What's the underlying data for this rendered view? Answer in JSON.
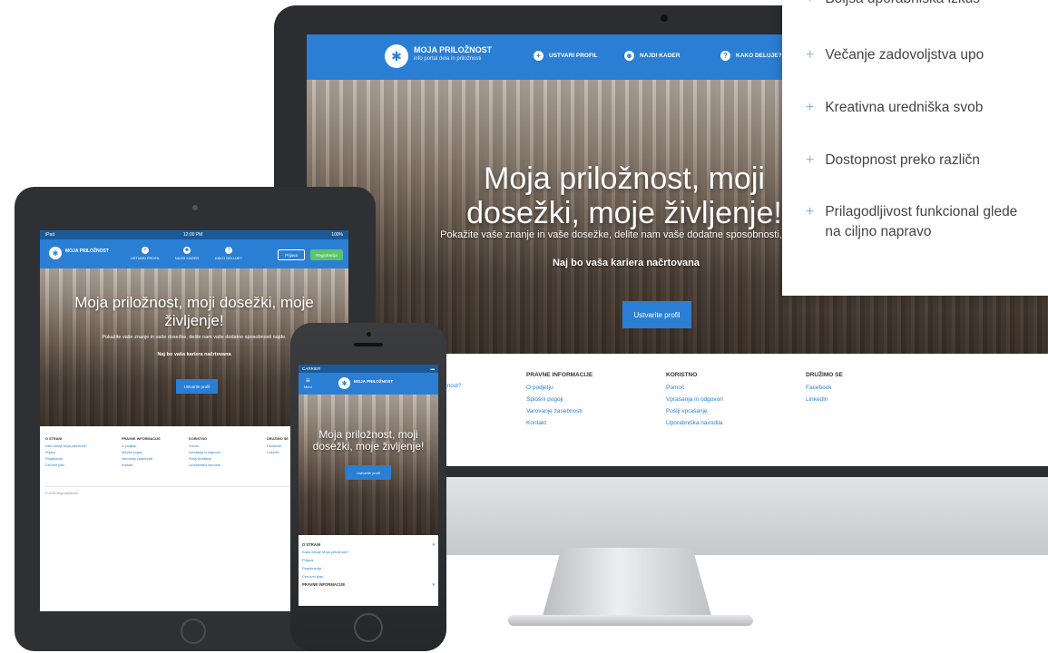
{
  "features": [
    "Boljša uporabniška izkuš",
    "Večanje zadovoljstva upo",
    "Kreativna uredniška svob",
    "Dostopnost preko različn",
    "Prilagodljivost funkcional glede na ciljno napravo"
  ],
  "monitor": {
    "logo_title": "MOJA PRILOŽNOST",
    "logo_subtitle": "info portal dela in priložnosti",
    "nav": [
      "USTVARI PROFIL",
      "NAJDI KADER",
      "KAKO DELUJE?"
    ],
    "hero_title": "Moja priložnost, moji dosežki, moje življenje!",
    "hero_text": "Pokažite vaše znanje in vaše dosežke, delite nam vaše dodatne sposobnosti, najde.",
    "hero_strong": "Naj bo vaša kariera načrtovana",
    "cta": "Ustvarite profil",
    "footer_cut": "iznost?",
    "footer": [
      {
        "heading": "PRAVNE INFORMACIJE",
        "links": [
          "O podjetju",
          "Splošni pogoji",
          "Varovanje zasebnosti",
          "Kontakt"
        ]
      },
      {
        "heading": "KORISTNO",
        "links": [
          "Pomoč",
          "Vprašanja in odgovori",
          "Pošlji vprašanje",
          "Uporabniška navodila"
        ]
      },
      {
        "heading": "DRUŽIMO SE",
        "links": [
          "Facebook",
          "LinkedIn"
        ]
      }
    ]
  },
  "tablet": {
    "status_left": "iPad",
    "status_center": "12:00 PM",
    "status_right": "100%",
    "logo_title": "MOJA PRILOŽNOST",
    "nav": [
      "USTVARI PROFIL",
      "NAJDI KADER",
      "KAKO DELUJE?"
    ],
    "login": "Prijava",
    "register": "Registracija",
    "hero_title": "Moja priložnost, moji dosežki, moje življenje!",
    "hero_text": "Pokažite vaše znanje in vaše dosežke, delite nam vaše dodatne sposobnosti najde.",
    "hero_strong": "Naj bo vaša kariera načrtovana",
    "cta": "Ustvarite profil",
    "footer": [
      {
        "heading": "O STRANI",
        "links": [
          "Kako deluje Moja priložnost?",
          "Prijava",
          "Registracija",
          "Cenovni plan"
        ]
      },
      {
        "heading": "PRAVNE INFORMACIJE",
        "links": [
          "O podjetju",
          "Splošni pogoji",
          "Varovanje zasebnosti",
          "Kontakt"
        ]
      },
      {
        "heading": "KORISTNO",
        "links": [
          "Pomoč",
          "Vprašanja in odgovori",
          "Pošlji vprašanje",
          "Uporabniška navodila"
        ]
      },
      {
        "heading": "DRUŽIMO SE",
        "links": [
          "Facebook",
          "LinkedIn"
        ]
      }
    ],
    "copyright": "© 2015 Moja priložnost"
  },
  "phone": {
    "carrier": "CARRIER",
    "menu": "Meni",
    "logo_title": "MOJA PRILOŽNOST",
    "hero_title": "Moja priložnost, moji dosežki, moje življenje!",
    "cta": "Ustvarite profil",
    "section1": "O STRANI",
    "links": [
      "Kako deluje Moja priložnost?",
      "Prijava",
      "Registracija",
      "Cenovni plan"
    ],
    "section2": "PRAVNE INFORMACIJE"
  }
}
